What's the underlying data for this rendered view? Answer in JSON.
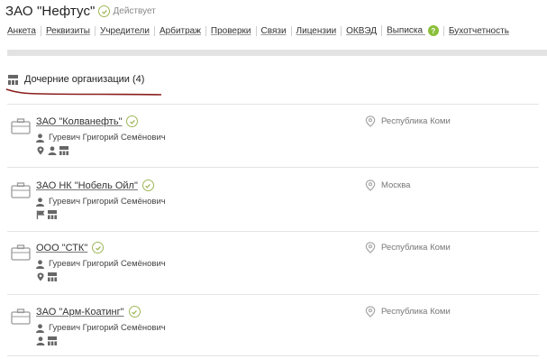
{
  "company": {
    "name": "ЗАО \"Нефтус\"",
    "status": "Действует"
  },
  "nav": {
    "items": [
      "Анкета",
      "Реквизиты",
      "Учредители",
      "Арбитраж",
      "Проверки",
      "Связи",
      "Лицензии",
      "ОКВЭД",
      "Выписка",
      "Бухотчетность"
    ],
    "help_badge": "?"
  },
  "section": {
    "title": "Дочерние организации (4)",
    "accent_color": "#8b1e1e"
  },
  "orgs": [
    {
      "name": "ЗАО \"Колванефть\"",
      "person": "Гуревич Григорий Семёнович",
      "region": "Республика Коми",
      "icons": [
        "location-icon",
        "person-icon",
        "org-structure-icon"
      ]
    },
    {
      "name": "ЗАО НК \"Нобель Ойл\"",
      "person": "Гуревич Григорий Семёнович",
      "region": "Москва",
      "icons": [
        "flag-icon",
        "org-structure-icon"
      ]
    },
    {
      "name": "ООО \"СТК\"",
      "person": "Гуревич Григорий Семёнович",
      "region": "Республика Коми",
      "icons": [
        "location-icon",
        "org-structure-icon"
      ]
    },
    {
      "name": "ЗАО \"Арм-Коатинг\"",
      "person": "Гуревич Григорий Семёнович",
      "region": "Республика Коми",
      "icons": [
        "person-icon",
        "org-structure-icon"
      ]
    }
  ]
}
